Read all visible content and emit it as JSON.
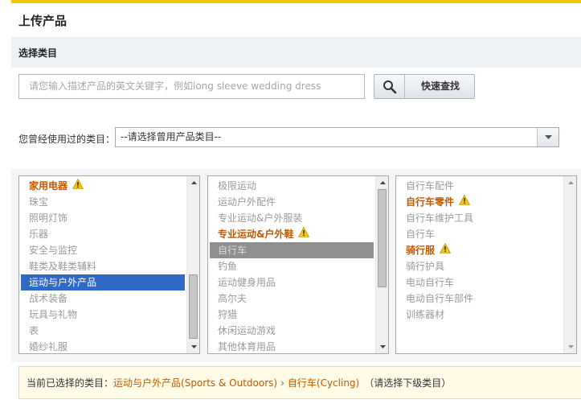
{
  "page": {
    "title": "上传产品"
  },
  "section": {
    "title": "选择类目"
  },
  "search": {
    "placeholder": "请您输入描述产品的英文关键字，例如long sleeve wedding dress",
    "button_label": "快速查找",
    "icon": "search-icon"
  },
  "used": {
    "label": "您曾经使用过的类目：",
    "selected": "--请选择曾用产品类目--"
  },
  "level1": [
    {
      "label": "家用电器",
      "style": "orange",
      "warning": true
    },
    {
      "label": "珠宝"
    },
    {
      "label": "照明灯饰"
    },
    {
      "label": "乐器"
    },
    {
      "label": "安全与监控"
    },
    {
      "label": "鞋类及鞋类辅料"
    },
    {
      "label": "运动与户外产品",
      "style": "sel-blue"
    },
    {
      "label": "战术装备"
    },
    {
      "label": "玩具与礼物"
    },
    {
      "label": "表"
    },
    {
      "label": "婚纱礼服"
    }
  ],
  "level2": [
    {
      "label": "极限运动"
    },
    {
      "label": "运动户外配件"
    },
    {
      "label": "专业运动&户外服装"
    },
    {
      "label": "专业运动&户外鞋",
      "style": "orange",
      "warning": true
    },
    {
      "label": "自行车",
      "style": "sel-grey"
    },
    {
      "label": "钓鱼"
    },
    {
      "label": "运动健身用品"
    },
    {
      "label": "高尔夫"
    },
    {
      "label": "狩猎"
    },
    {
      "label": "休闲运动游戏"
    },
    {
      "label": "其他体育用品"
    }
  ],
  "level3": [
    {
      "label": "自行车配件"
    },
    {
      "label": "自行车零件",
      "style": "orange",
      "warning": true
    },
    {
      "label": "自行车维护工具"
    },
    {
      "label": "自行车"
    },
    {
      "label": "骑行服",
      "style": "orange",
      "warning": true
    },
    {
      "label": "骑行护具"
    },
    {
      "label": "电动自行车"
    },
    {
      "label": "电动自行车部件"
    },
    {
      "label": "训练器材"
    }
  ],
  "current": {
    "label": "当前已选择的类目：",
    "crumbs": [
      "运动与户外产品(Sports & Outdoors)",
      "自行车(Cycling)"
    ],
    "separator": "›",
    "hint": "（请选择下级类目）"
  },
  "colors": {
    "accent_bar": "#f5c400",
    "orange_text": "#c25a00",
    "selected_blue": "#3169c6",
    "selected_grey": "#8f8f8f",
    "warning_yellow": "#f2c511"
  }
}
